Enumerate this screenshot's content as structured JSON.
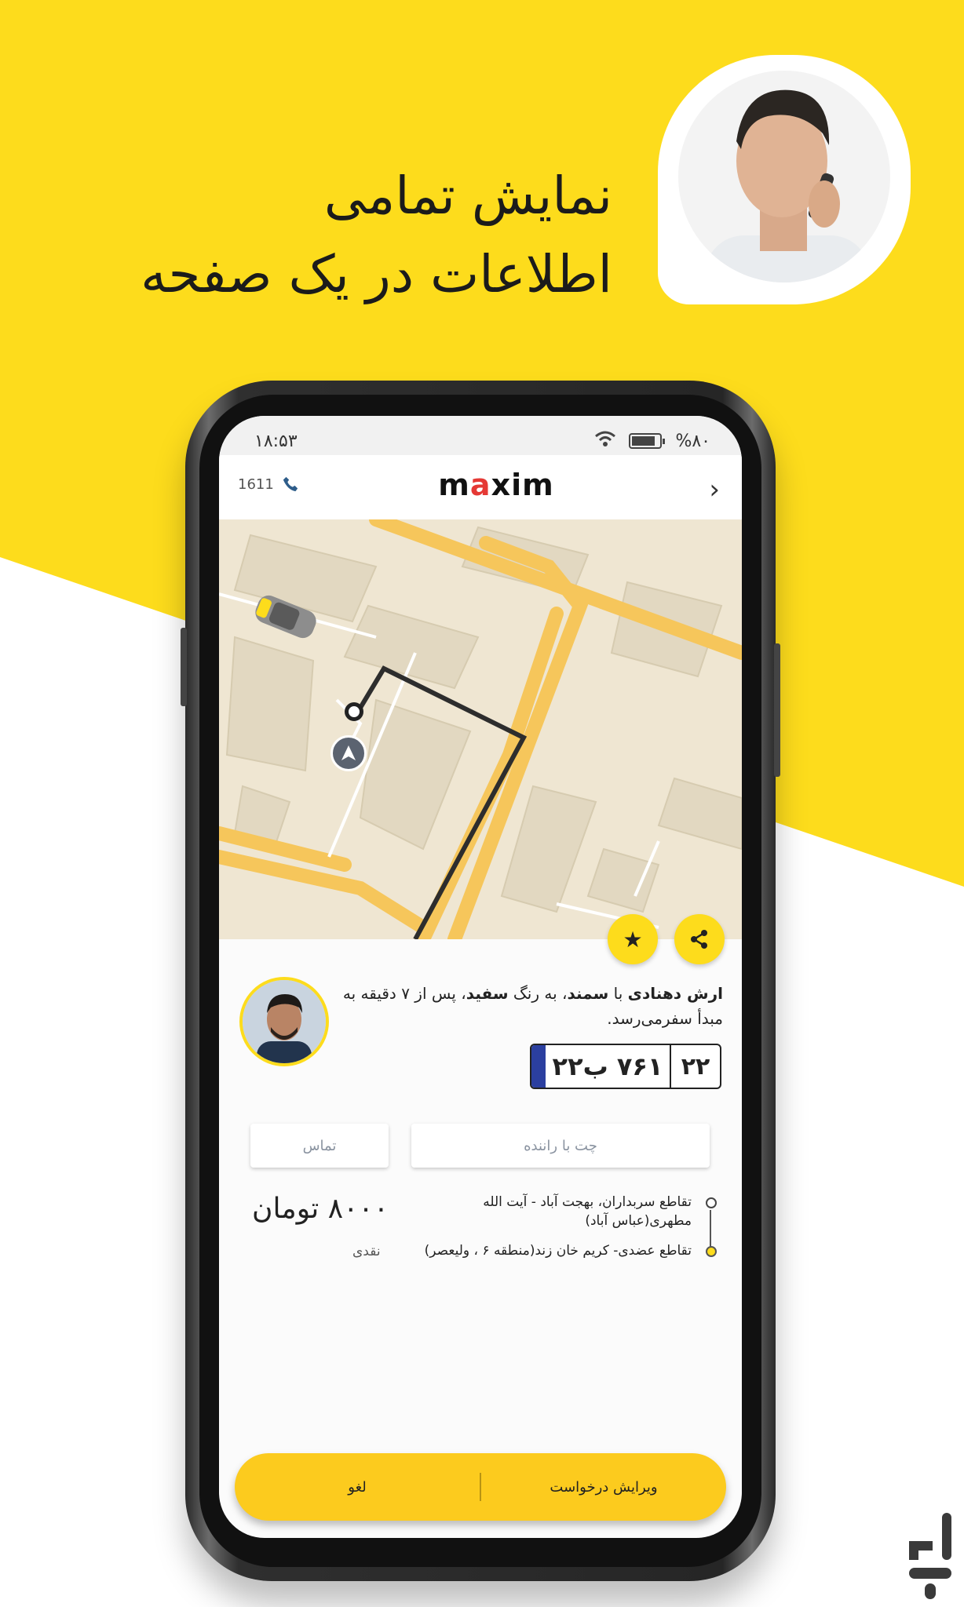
{
  "promo": {
    "headline_line1": "نمایش تمامی",
    "headline_line2": "اطلاعات در یک صفحه",
    "colors": {
      "brand_yellow": "#fddc1c",
      "button_yellow": "#fccb1e",
      "logo_accent": "#e53935"
    }
  },
  "statusbar": {
    "time": "۱۸:۵۳",
    "battery": "%۸۰"
  },
  "appbar": {
    "hotline": "1611",
    "logo_prefix": "m",
    "logo_accent": "a",
    "logo_suffix": "xim",
    "forward_icon": "chevron-right-icon",
    "phone_icon": "phone-icon"
  },
  "map": {
    "car_icon": "taxi-car-icon",
    "pickup_icon": "navigation-pin-icon"
  },
  "actions": {
    "favorite_icon": "star-icon",
    "share_icon": "share-icon"
  },
  "driver": {
    "name": "ارش دهنادی",
    "t1": " با ",
    "car": "سمند",
    "t2": "، به رنگ ",
    "color": "سفید",
    "t3": "، پس از ۷ دقیقه به مبدأ سفرمی‌رسد.",
    "plate_main": "۷۶۱ ب۲۲",
    "plate_region": "۲۲"
  },
  "buttons": {
    "chat": "چت با راننده",
    "call": "تماس"
  },
  "route": {
    "origin": "تقاطع سربداران، بهجت آباد - آیت الله مطهری(عباس آباد)",
    "destination": "تقاطع عضدی- کریم خان زند(منطقه ۶ ، ولیعصر)"
  },
  "fare": {
    "price": "۸۰۰۰ تومان",
    "payment": "نقدی"
  },
  "bottom": {
    "edit": "ویرایش درخواست",
    "cancel": "لغو"
  }
}
